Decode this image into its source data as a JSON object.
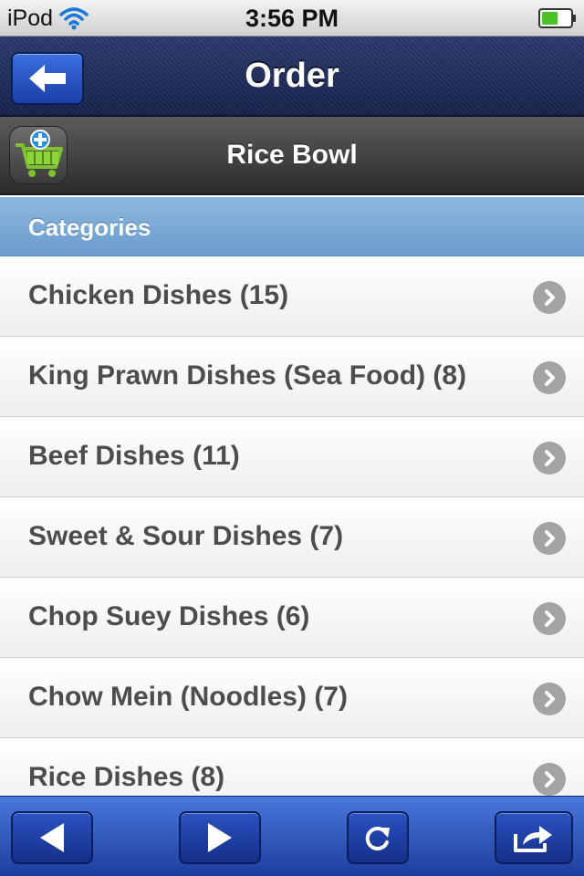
{
  "status_bar": {
    "carrier": "iPod",
    "time": "3:56 PM"
  },
  "nav": {
    "title": "Order",
    "back_icon": "back-arrow-icon"
  },
  "restaurant": {
    "name": "Rice Bowl",
    "cart_icon": "add-to-cart-icon"
  },
  "categories": {
    "header": "Categories",
    "items": [
      {
        "label": "Chicken Dishes (15)"
      },
      {
        "label": "King Prawn Dishes (Sea Food) (8)"
      },
      {
        "label": "Beef Dishes (11)"
      },
      {
        "label": "Sweet & Sour Dishes (7)"
      },
      {
        "label": "Chop Suey Dishes (6)"
      },
      {
        "label": "Chow Mein (Noodles) (7)"
      },
      {
        "label": "Rice Dishes (8)"
      }
    ]
  },
  "toolbar": {
    "buttons": [
      "back-icon",
      "forward-icon",
      "refresh-icon",
      "share-icon"
    ]
  },
  "colors": {
    "nav_bar": "#1f2d5c",
    "category_header": "#7ba9d6",
    "list_text": "#4d4d4d",
    "toolbar": "#2f5bc8",
    "battery": "#4cc22a"
  }
}
